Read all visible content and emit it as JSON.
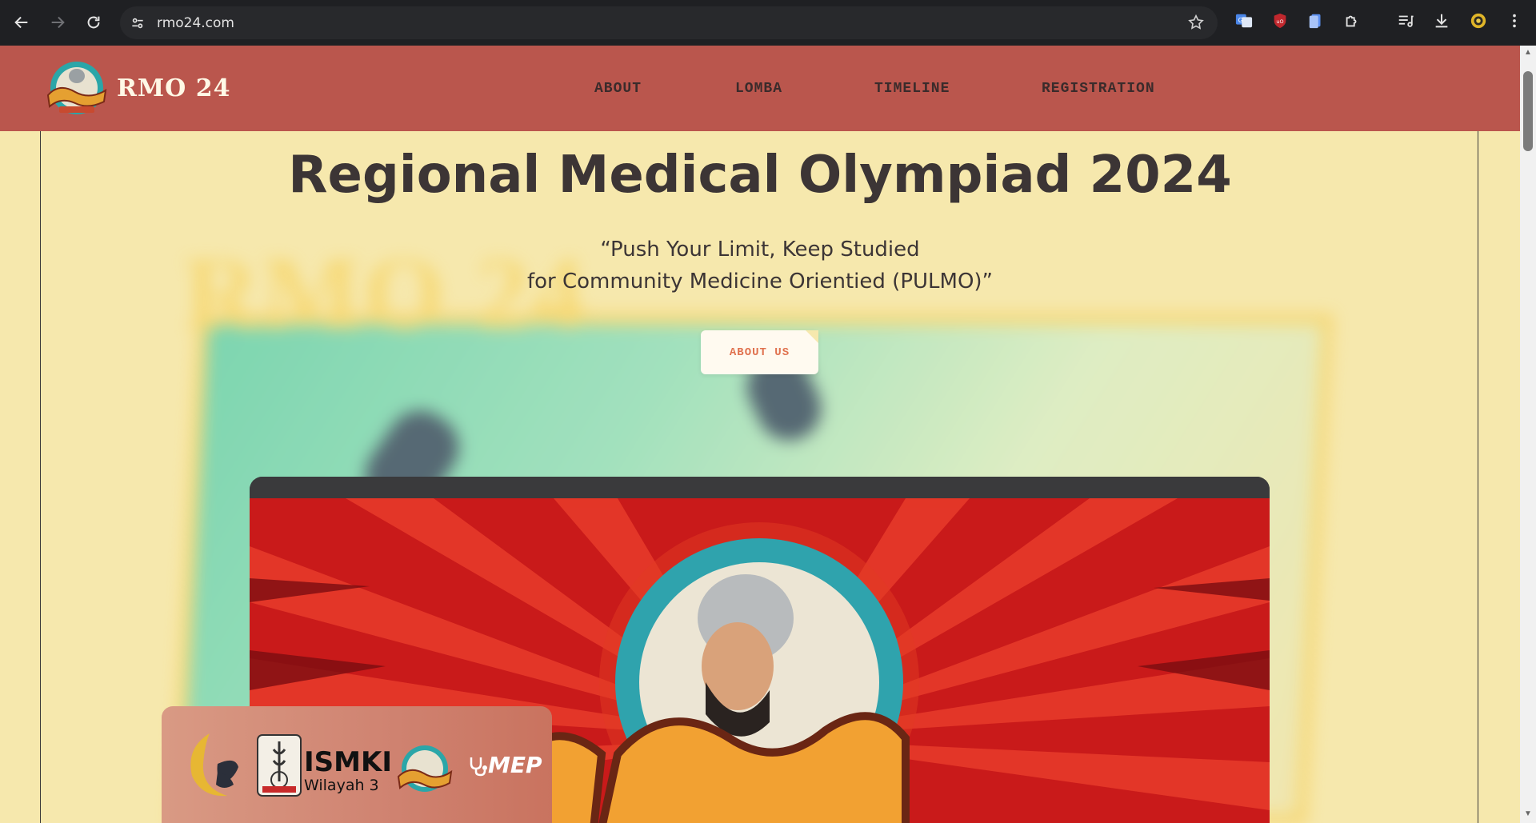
{
  "browser": {
    "url": "rmo24.com"
  },
  "site": {
    "name": "RMO 24",
    "nav": [
      "ABOUT",
      "LOMBA",
      "TIMELINE",
      "REGISTRATION"
    ]
  },
  "hero": {
    "title": "Regional Medical Olympiad 2024",
    "quote_line1": "“Push Your Limit, Keep Studied",
    "quote_line2": "for Community Medicine Orientied (PULMO)”",
    "button_label": "ABOUT US",
    "background_word": "RMO 24"
  },
  "sponsors": {
    "ismki_name": "ISMKI",
    "ismki_region": "Wilayah 3",
    "mep_name": "MEP"
  },
  "colors": {
    "page_bg": "#f6e8ad",
    "header_bg": "#ba564d",
    "button_text": "#e0714e"
  }
}
